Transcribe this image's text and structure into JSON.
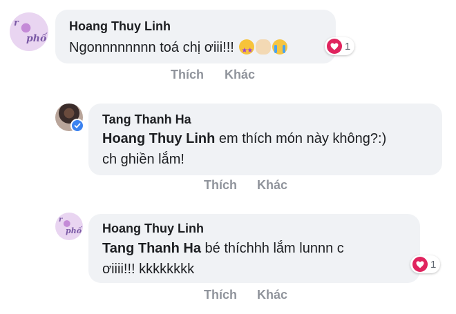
{
  "comments": [
    {
      "author": "Hoang Thuy Linh",
      "text": "Ngonnnnnnnn toá chị ơiii!!!",
      "emojis": [
        "star-struck-emoji",
        "clapping-hands-emoji",
        "loudly-crying-emoji"
      ],
      "reaction_count": "1",
      "like_label": "Thích",
      "more_label": "Khác"
    },
    {
      "author": "Tang Thanh Ha",
      "mention": "Hoang Thuy Linh",
      "text_line1": " em thích món này không?:)",
      "text_line2": "ch ghiền lắm!",
      "like_label": "Thích",
      "more_label": "Khác"
    },
    {
      "author": "Hoang Thuy Linh",
      "mention": "Tang Thanh Ha",
      "text_line1": " bé thíchhh lắm lunnn c",
      "text_line2": "ơiiii!!! kkkkkkkk",
      "reaction_count": "1",
      "like_label": "Thích",
      "more_label": "Khác"
    }
  ],
  "colors": {
    "bubble": "#f0f2f5",
    "action_text": "#90949c",
    "heart": "#e0245e",
    "verified": "#3b82f0"
  }
}
